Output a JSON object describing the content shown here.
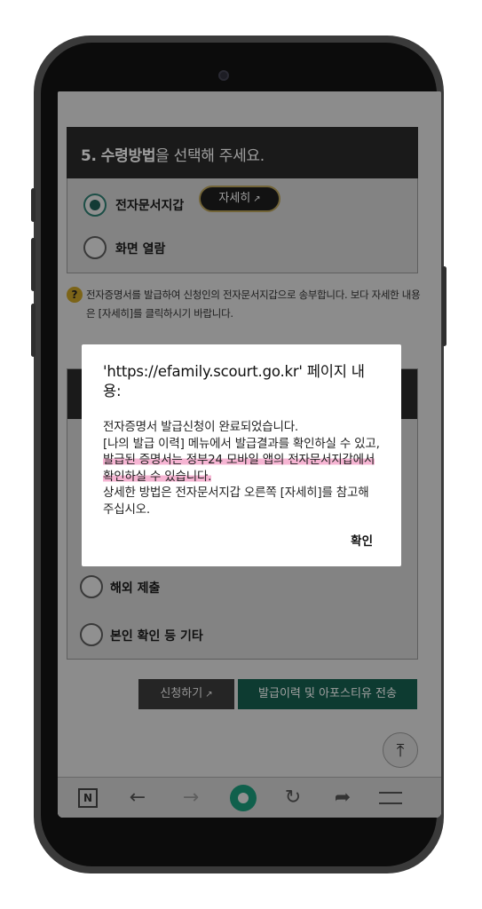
{
  "section": {
    "number": "5.",
    "title_bold": "수령방법",
    "title_rest": "을 선택해 주세요.",
    "options": [
      {
        "label": "전자문서지갑",
        "selected": true
      },
      {
        "label": "화면 열람",
        "selected": false
      }
    ],
    "detail_button": "자세히"
  },
  "notice": {
    "icon": "question-icon",
    "text": "전자증명서를 발급하여 신청인의 전자문서지갑으로 송부합니다. 보다 자세한 내용은 [자세히]를 클릭하시기 바랍니다."
  },
  "purpose": {
    "options": [
      {
        "label": "해외 제출"
      },
      {
        "label": "본인 확인 등 기타"
      }
    ]
  },
  "actions": {
    "apply": "신청하기",
    "send": "발급이력 및 아포스티유 전송"
  },
  "dialog": {
    "title": "'https://efamily.scourt.go.kr' 페이지 내용:",
    "line1": "전자증명서 발급신청이 완료되었습니다.",
    "line2a": "[나의 발급 이력] 메뉴에서 발급결과를 확인하실 수 있고, ",
    "line2b": "발급된 증명서는 정부24 모바일 앱의 전자문서지갑에서 확인하실 수 있습니다.",
    "line3": "상세한 방법은 전자문서지갑 오른쪽 [자세히]를 참고해 주십시오.",
    "ok": "확인"
  },
  "browser_nav": {
    "n_label": "N",
    "icons": [
      "back-icon",
      "forward-icon",
      "home-icon",
      "refresh-icon",
      "share-icon",
      "menu-icon"
    ]
  },
  "colors": {
    "accent_green": "#155f50",
    "highlight": "#f6b5d3"
  }
}
